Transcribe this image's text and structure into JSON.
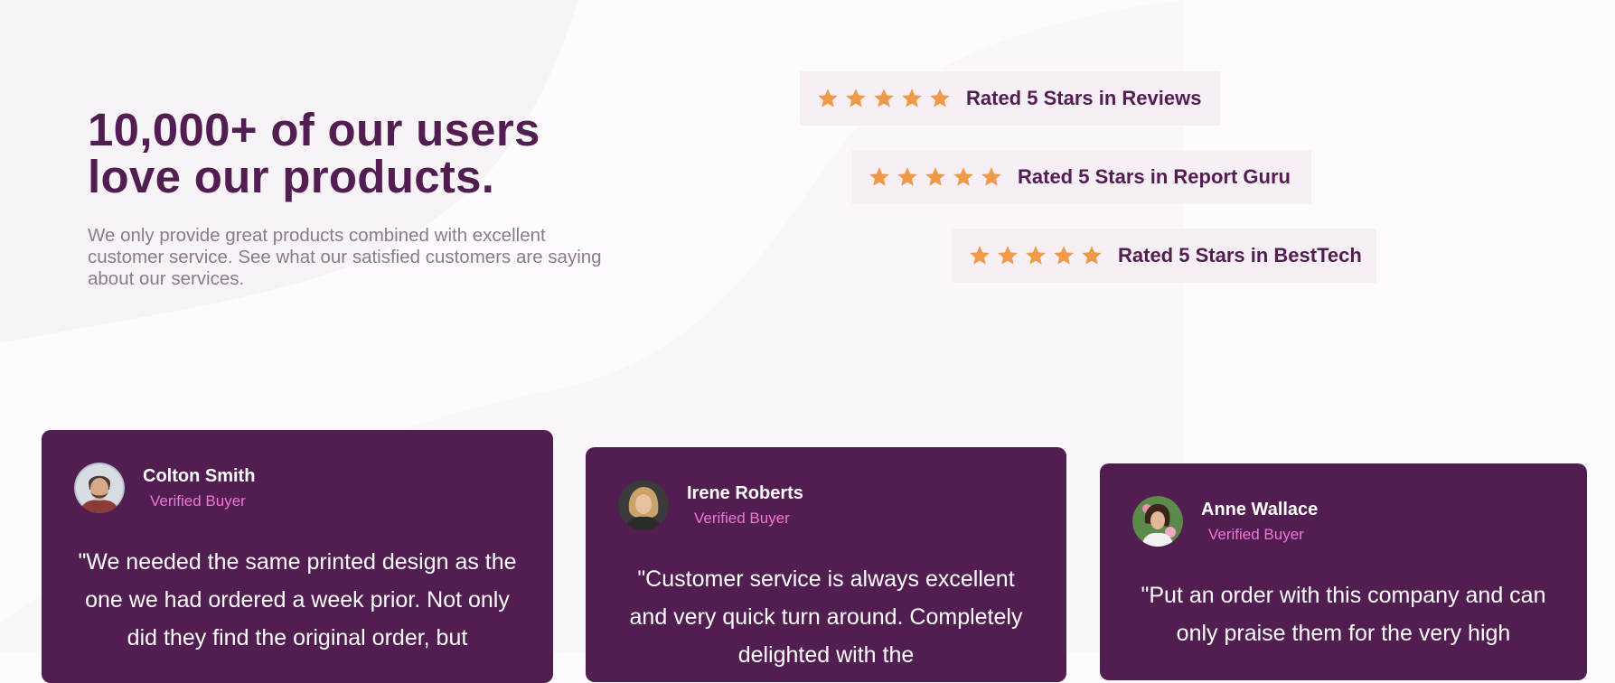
{
  "hero": {
    "title_line1": "10,000+ of our users",
    "title_line2": "love our products.",
    "description": "We only provide great products combined with excellent customer service. See what our satisfied customers are saying about our services."
  },
  "ratings": [
    {
      "label": "Rated 5 Stars in Reviews",
      "stars": 5
    },
    {
      "label": "Rated 5 Stars in Report Guru",
      "stars": 5
    },
    {
      "label": "Rated 5 Stars in BestTech",
      "stars": 5
    }
  ],
  "testimonials": [
    {
      "name": "Colton Smith",
      "badge": "Verified Buyer",
      "quote": "\"We needed the same printed design as the one we had ordered a week prior. Not only did they find the original order, but"
    },
    {
      "name": "Irene Roberts",
      "badge": "Verified Buyer",
      "quote": "\"Customer service is always excellent and very quick turn around. Completely delighted with the"
    },
    {
      "name": "Anne Wallace",
      "badge": "Verified Buyer",
      "quote": "\"Put an order with this company and can only praise them for the very high"
    }
  ],
  "colors": {
    "primary": "#521e52",
    "star": "#ee9a48",
    "rating_bg": "#f6eff6",
    "verified": "#ee75d2",
    "body_text": "#8b7b8b"
  }
}
